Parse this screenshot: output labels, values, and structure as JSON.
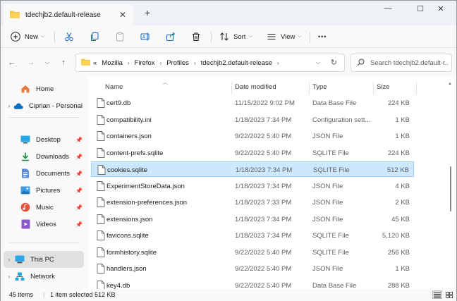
{
  "window": {
    "tab_title": "tdechjb2.default-release",
    "new_tab_symbol": "+",
    "controls": [
      "—",
      "☐",
      "✕"
    ]
  },
  "toolbar": {
    "new_label": "New",
    "sort_label": "Sort",
    "view_label": "View",
    "more_label": "•••"
  },
  "address": {
    "overflow": "«",
    "crumbs": [
      "Mozilla",
      "Firefox",
      "Profiles",
      "tdechjb2.default-release"
    ],
    "search_placeholder": "Search tdechjb2.default-r..."
  },
  "sidebar": {
    "items": [
      {
        "label": "Home",
        "icon": "home-icon"
      },
      {
        "label": "Ciprian - Personal",
        "icon": "cloud-icon"
      },
      {
        "label": "Desktop",
        "icon": "desktop-icon"
      },
      {
        "label": "Downloads",
        "icon": "download-icon"
      },
      {
        "label": "Documents",
        "icon": "documents-icon"
      },
      {
        "label": "Pictures",
        "icon": "pictures-icon"
      },
      {
        "label": "Music",
        "icon": "music-icon"
      },
      {
        "label": "Videos",
        "icon": "videos-icon"
      },
      {
        "label": "This PC",
        "icon": "this-pc-icon"
      },
      {
        "label": "Network",
        "icon": "network-icon"
      }
    ]
  },
  "columns": {
    "name": "Name",
    "date": "Date modified",
    "type": "Type",
    "size": "Size"
  },
  "files": [
    {
      "name": "cert9.db",
      "date": "11/15/2022 9:02 PM",
      "type": "Data Base File",
      "size": "224 KB"
    },
    {
      "name": "compatibility.ini",
      "date": "1/18/2023 7:34 PM",
      "type": "Configuration sett...",
      "size": "1 KB"
    },
    {
      "name": "containers.json",
      "date": "9/22/2022 5:40 PM",
      "type": "JSON File",
      "size": "1 KB"
    },
    {
      "name": "content-prefs.sqlite",
      "date": "9/22/2022 5:40 PM",
      "type": "SQLITE File",
      "size": "224 KB"
    },
    {
      "name": "cookies.sqlite",
      "date": "1/18/2023 7:34 PM",
      "type": "SQLITE File",
      "size": "512 KB"
    },
    {
      "name": "ExperimentStoreData.json",
      "date": "1/18/2023 7:34 PM",
      "type": "JSON File",
      "size": "4 KB"
    },
    {
      "name": "extension-preferences.json",
      "date": "1/18/2023 7:33 PM",
      "type": "JSON File",
      "size": "2 KB"
    },
    {
      "name": "extensions.json",
      "date": "1/18/2023 7:34 PM",
      "type": "JSON File",
      "size": "45 KB"
    },
    {
      "name": "favicons.sqlite",
      "date": "1/18/2023 7:34 PM",
      "type": "SQLITE File",
      "size": "5,120 KB"
    },
    {
      "name": "formhistory.sqlite",
      "date": "9/22/2022 5:40 PM",
      "type": "SQLITE File",
      "size": "256 KB"
    },
    {
      "name": "handlers.json",
      "date": "9/22/2022 5:40 PM",
      "type": "JSON File",
      "size": "1 KB"
    },
    {
      "name": "key4.db",
      "date": "9/22/2022 5:40 PM",
      "type": "Data Base File",
      "size": "288 KB"
    }
  ],
  "status": {
    "items_count": "45 items",
    "selection": "1 item selected  512 KB"
  },
  "colors": {
    "accent_folder": "#f5c342",
    "selection_bg": "#cce8ff",
    "selection_border": "#99d1ff"
  }
}
